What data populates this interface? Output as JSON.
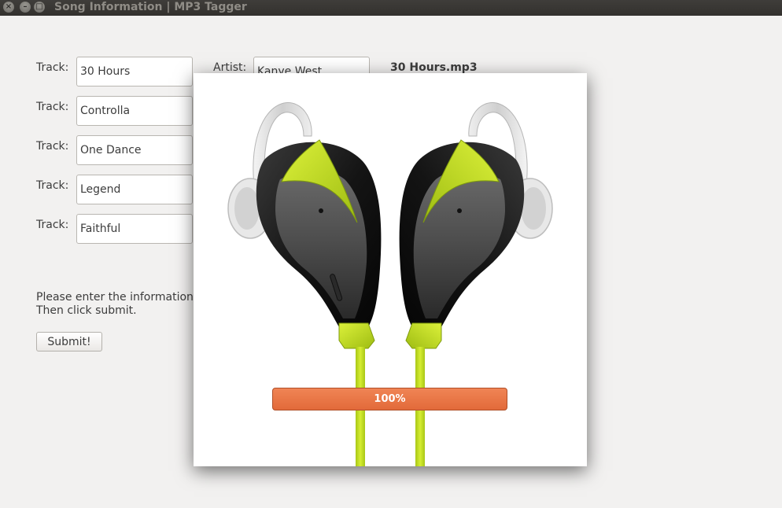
{
  "window": {
    "title": "Song Information | MP3 Tagger",
    "buttons": {
      "close": "×",
      "minimize": "–",
      "maximize": "□"
    }
  },
  "form": {
    "track_label": "Track:",
    "artist_label": "Artist:",
    "tracks": [
      "30 Hours",
      "Controlla",
      "One Dance",
      "Legend",
      "Faithful"
    ],
    "artist_value": "Kanye West",
    "filename": "30 Hours.mp3",
    "info_line1": "Please enter the information",
    "info_line2": "Then click submit.",
    "submit_label": "Submit!"
  },
  "splash": {
    "image": "wireless-earbuds-product-image",
    "progress_text": "100%",
    "progress_fraction": 1.0,
    "colors": {
      "progress": "#e8733f",
      "earbud_accent": "#c8e62a",
      "earbud_body": "#1a1a1a"
    }
  }
}
